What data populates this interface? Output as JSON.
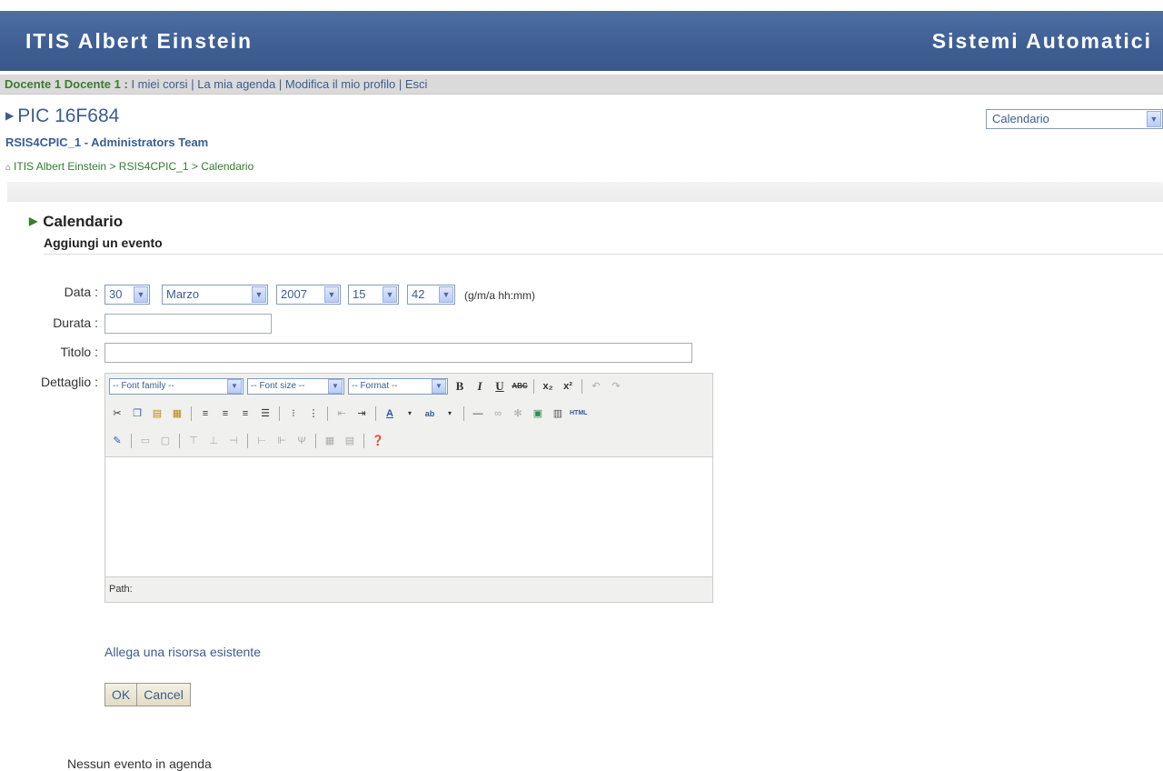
{
  "header": {
    "site_title": "ITIS Albert Einstein",
    "site_right": "Sistemi Automatici"
  },
  "userbar": {
    "user_name": "Docente 1 Docente 1 :",
    "links": [
      "I miei corsi",
      "La mia agenda",
      "Modifica il mio profilo",
      "Esci"
    ]
  },
  "course": {
    "title": "PIC 16F684",
    "team": "RSIS4CPIC_1 - Administrators Team",
    "breadcrumb": [
      "ITIS Albert Einstein",
      "RSIS4CPIC_1",
      "Calendario"
    ],
    "breadcrumb_sep": ">"
  },
  "jump_menu": {
    "selected": "Calendario"
  },
  "section": {
    "title": "Calendario",
    "subtitle": "Aggiungi un evento"
  },
  "form": {
    "date_label": "Data :",
    "day": "30",
    "month": "Marzo",
    "year": "2007",
    "hour": "15",
    "minute": "42",
    "date_format": "(g/m/a hh:mm)",
    "duration_label": "Durata :",
    "duration_value": "",
    "title_label": "Titolo :",
    "title_value": "",
    "detail_label": "Dettaglio :"
  },
  "editor": {
    "font_family": "-- Font family --",
    "font_size": "-- Font size --",
    "format": "-- Format --",
    "html_button": "HTML",
    "path_label": "Path:"
  },
  "attach_link": "Allega una risorsa esistente",
  "buttons": {
    "ok": "OK",
    "cancel": "Cancel"
  },
  "no_events": "Nessun evento in agenda",
  "colors": {
    "header_bg": "#3f5f95",
    "link": "#3b5d93",
    "user_name": "#3a7d2b"
  },
  "icons": {
    "course_bullet": "triangle-right-icon",
    "home": "home-icon",
    "dropdown": "chevron-down-icon"
  }
}
